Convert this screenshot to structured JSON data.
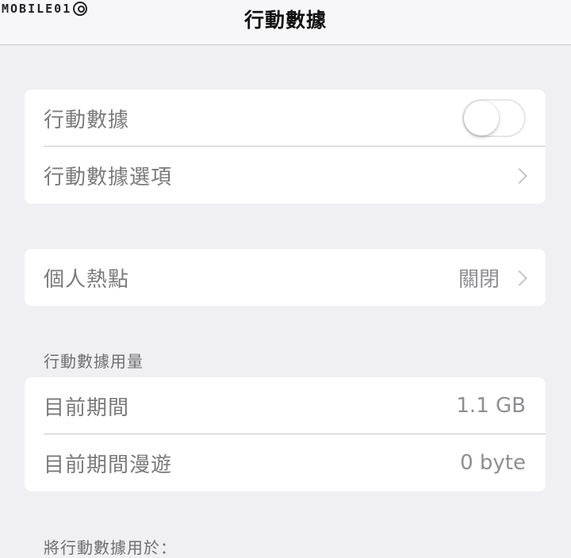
{
  "watermark": {
    "text": "MOBILE01"
  },
  "navbar": {
    "title": "行動數據"
  },
  "cellular_group": {
    "toggle_row": {
      "label": "行動數據",
      "enabled": false
    },
    "options_row": {
      "label": "行動數據選項"
    }
  },
  "hotspot_group": {
    "row": {
      "label": "個人熱點",
      "value": "關閉"
    }
  },
  "usage_section": {
    "header": "行動數據用量",
    "current_period": {
      "label": "目前期間",
      "value": "1.1 GB"
    },
    "current_roaming": {
      "label": "目前期間漫遊",
      "value": "0 byte"
    }
  },
  "apps_section": {
    "header": "將行動數據用於："
  }
}
